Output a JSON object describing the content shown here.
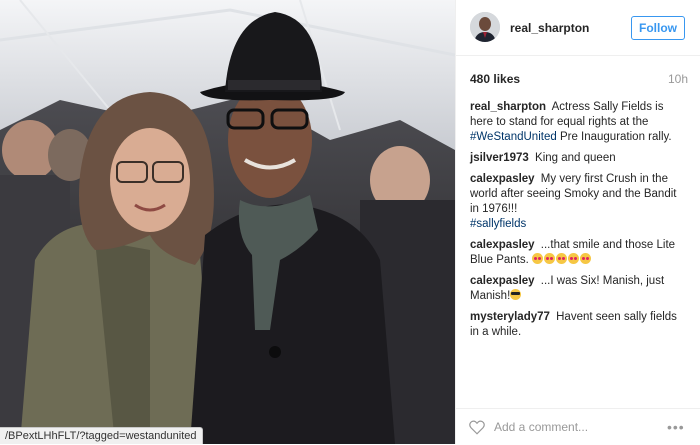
{
  "photo": {
    "status_url": "/BPextLHhFLT/?tagged=westandunited"
  },
  "header": {
    "username": "real_sharpton",
    "follow_label": "Follow"
  },
  "post": {
    "likes": "480 likes",
    "time": "10h"
  },
  "comments": [
    {
      "author": "real_sharpton",
      "text": "Actress Sally Fields is here to stand for equal rights at the",
      "tag": "#WeStandUnited",
      "text_after": "Pre Inauguration rally."
    },
    {
      "author": "jsilver1973",
      "text": "King and queen"
    },
    {
      "author": "calexpasley",
      "text": "My very first Crush in the world after seeing Smoky and the Bandit in 1976!!!",
      "tag": "#sallyfields"
    },
    {
      "author": "calexpasley",
      "text": "...that smile and those Lite Blue Pants."
    },
    {
      "author": "calexpasley",
      "text": "...I was Six! Manish, just Manish!"
    },
    {
      "author": "mysterylady77",
      "text": "Havent seen sally fields in a while."
    }
  ],
  "footer": {
    "comment_placeholder": "Add a comment...",
    "more_label": "•••"
  }
}
